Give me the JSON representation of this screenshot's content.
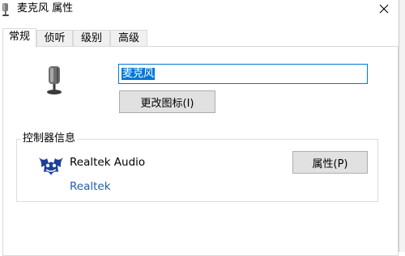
{
  "window": {
    "title": "麦克风 属性"
  },
  "tabs": [
    {
      "label": "常规",
      "active": true
    },
    {
      "label": "侦听",
      "active": false
    },
    {
      "label": "级别",
      "active": false
    },
    {
      "label": "高级",
      "active": false
    }
  ],
  "general": {
    "device_name_value": "麦克风",
    "change_icon_label": "更改图标(I)",
    "controller_group_title": "控制器信息",
    "controller_name": "Realtek Audio",
    "controller_link": "Realtek",
    "properties_label": "属性(P)"
  },
  "colors": {
    "accent": "#0078d7",
    "link": "#1f5fa8",
    "button_bg": "#e1e1e1"
  },
  "icons": {
    "title": "microphone-icon",
    "device": "microphone-icon",
    "controller": "realtek-logo-icon",
    "close": "close-icon"
  }
}
